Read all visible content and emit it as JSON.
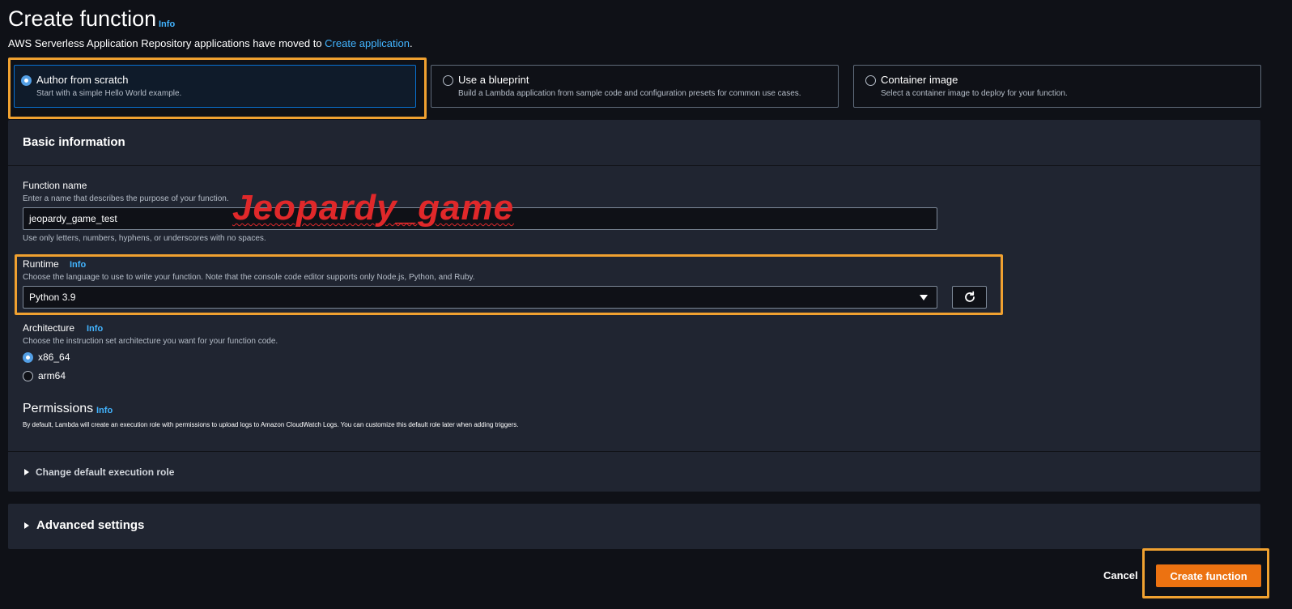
{
  "header": {
    "title": "Create function",
    "info_label": "Info",
    "notice_text": "AWS Serverless Application Repository applications have moved to ",
    "notice_link": "Create application",
    "notice_end": "."
  },
  "options": [
    {
      "title": "Author from scratch",
      "desc": "Start with a simple Hello World example.",
      "selected": true
    },
    {
      "title": "Use a blueprint",
      "desc": "Build a Lambda application from sample code and configuration presets for common use cases.",
      "selected": false
    },
    {
      "title": "Container image",
      "desc": "Select a container image to deploy for your function.",
      "selected": false
    }
  ],
  "basic": {
    "title": "Basic information",
    "function_name": {
      "label": "Function name",
      "desc": "Enter a name that describes the purpose of your function.",
      "value": "jeopardy_game_test",
      "hint": "Use only letters, numbers, hyphens, or underscores with no spaces."
    },
    "runtime": {
      "label": "Runtime",
      "info": "Info",
      "desc": "Choose the language to use to write your function. Note that the console code editor supports only Node.js, Python, and Ruby.",
      "value": "Python 3.9"
    },
    "architecture": {
      "label": "Architecture",
      "info": "Info",
      "desc": "Choose the instruction set architecture you want for your function code.",
      "options": [
        "x86_64",
        "arm64"
      ],
      "selected": "x86_64"
    },
    "permissions": {
      "title": "Permissions",
      "info": "Info",
      "desc": "By default, Lambda will create an execution role with permissions to upload logs to Amazon CloudWatch Logs. You can customize this default role later when adding triggers."
    },
    "execution_role": "Change default execution role"
  },
  "advanced": {
    "title": "Advanced settings"
  },
  "annotation": "Jeopardy_game",
  "footer": {
    "cancel": "Cancel",
    "create": "Create function"
  },
  "colors": {
    "accent": "#42b4ff",
    "highlight": "#f0a130",
    "primary": "#ec7211",
    "annotation": "#e0282a"
  }
}
